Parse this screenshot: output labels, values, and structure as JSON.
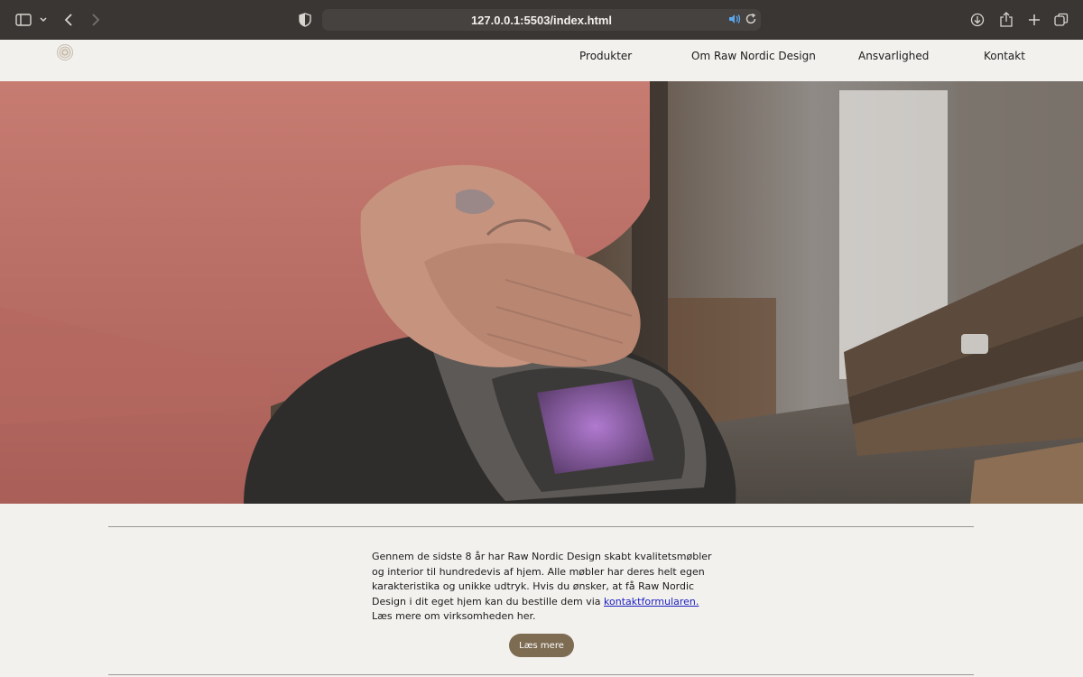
{
  "browser": {
    "url": "127.0.0.1:5503/index.html"
  },
  "nav": {
    "items": [
      {
        "label": "Produkter"
      },
      {
        "label": "Om Raw Nordic Design"
      },
      {
        "label": "Ansvarlighed"
      },
      {
        "label": "Kontakt"
      }
    ]
  },
  "hero": {
    "alt": "Hands resting on a welding helmet in a workshop"
  },
  "intro": {
    "text_before_link": "Gennem de sidste 8 år har Raw Nordic Design skabt kvalitetsmøbler og interior til hundredevis af hjem. Alle møbler har deres helt egen karakteristika og unikke udtryk. Hvis du ønsker, at få Raw Nordic Design i dit eget hjem kan du bestille dem via ",
    "link_text": "kontaktformularen.",
    "text_after_link": " Læs mere om virksomheden her."
  },
  "cta": {
    "label": "Læs mere"
  },
  "colors": {
    "chrome": "#3a3633",
    "background": "#f3f1ee",
    "button": "#7d6b52",
    "link": "#1a1ec0"
  }
}
